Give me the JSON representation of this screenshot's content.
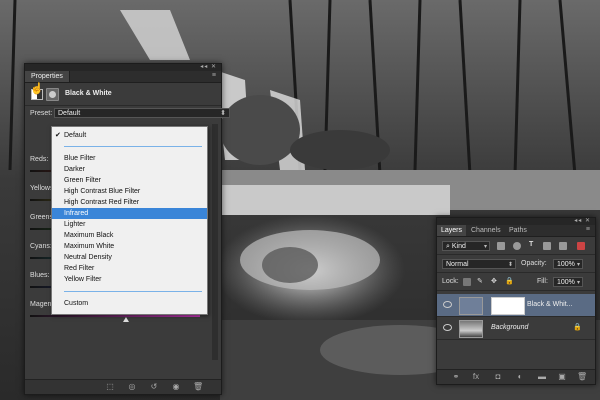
{
  "properties": {
    "tab": "Properties",
    "panel_controls": "◂◂ ✕",
    "menu_icon": "panel-menu-icon",
    "adjustment_title": "Black & White",
    "preset_label": "Preset:",
    "preset_value": "Default",
    "sliders": [
      {
        "label": "Reds:",
        "color": "#c0392b"
      },
      {
        "label": "Yellows:",
        "color": "#d4c331"
      },
      {
        "label": "Greens:",
        "color": "#3ca33c"
      },
      {
        "label": "Cyans:",
        "color": "#35b3c3"
      },
      {
        "label": "Blues:",
        "color": "#3552c3"
      },
      {
        "label": "Magentas:",
        "color": "#c335b5"
      }
    ]
  },
  "preset_dropdown": {
    "checked_item": "Default",
    "items": [
      "Default",
      "Blue Filter",
      "Darker",
      "Green Filter",
      "High Contrast Blue Filter",
      "High Contrast Red Filter",
      "Infrared",
      "Lighter",
      "Maximum Black",
      "Maximum White",
      "Neutral Density",
      "Red Filter",
      "Yellow Filter",
      "Custom"
    ],
    "selected": "Infrared"
  },
  "layers": {
    "tabs": [
      "Layers",
      "Channels",
      "Paths"
    ],
    "active_tab": "Layers",
    "filter_label": "Kind",
    "blend_mode": "Normal",
    "opacity_label": "Opacity:",
    "opacity_value": "100%",
    "lock_label": "Lock:",
    "fill_label": "Fill:",
    "fill_value": "100%",
    "items": [
      {
        "name": "Black & Whit...",
        "selected": true
      },
      {
        "name": "Background",
        "selected": false
      }
    ],
    "footer_icons": [
      "link-icon",
      "fx-icon",
      "mask-icon",
      "adjustment-icon",
      "folder-icon",
      "new-layer-icon",
      "trash-icon"
    ]
  },
  "colors": {
    "panel_bg": "#3b3b3b",
    "selection_blue": "#3a85d8",
    "layer_selected": "#5a6b84"
  }
}
